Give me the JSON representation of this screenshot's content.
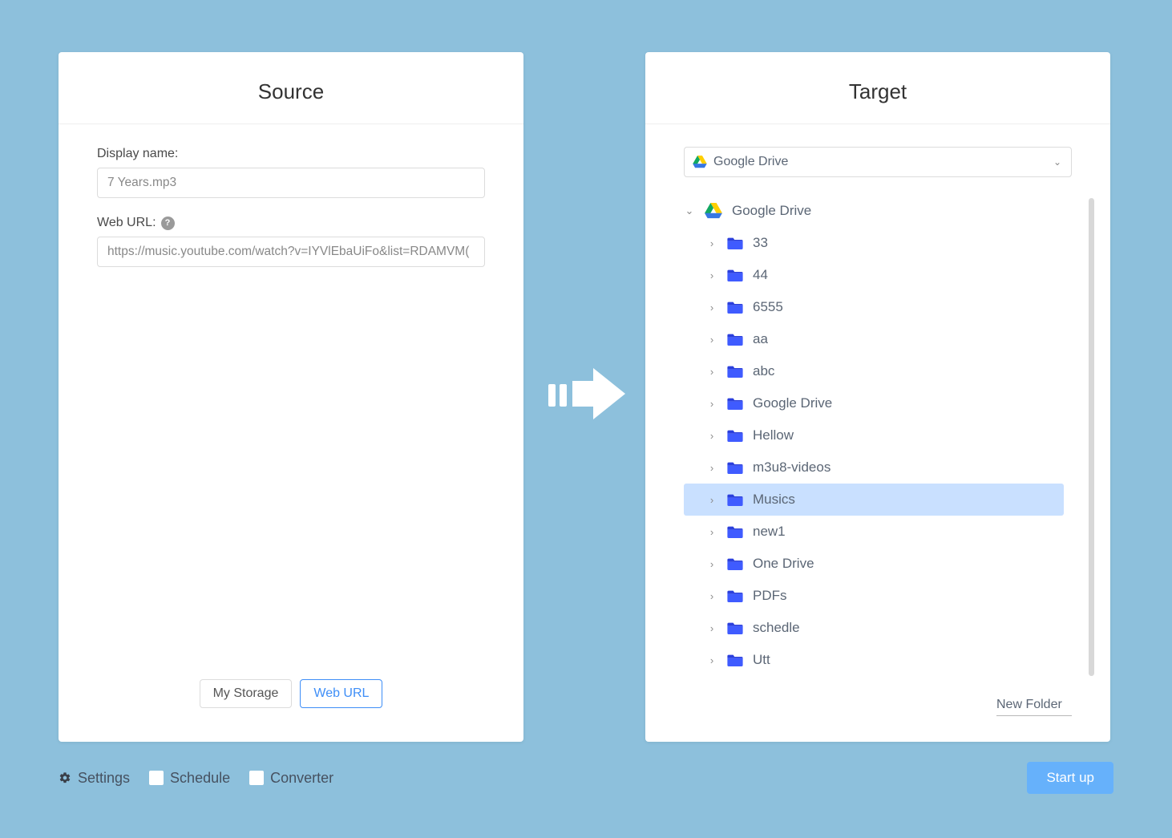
{
  "source": {
    "title": "Source",
    "display_name_label": "Display name:",
    "display_name_value": "7 Years.mp3",
    "web_url_label": "Web URL:",
    "web_url_value": "https://music.youtube.com/watch?v=IYVlEbaUiFo&list=RDAMVM(",
    "tabs": {
      "my_storage": "My Storage",
      "web_url": "Web URL"
    }
  },
  "target": {
    "title": "Target",
    "selected_drive": "Google Drive",
    "root_label": "Google Drive",
    "folders": [
      {
        "name": "33",
        "selected": false
      },
      {
        "name": "44",
        "selected": false
      },
      {
        "name": "6555",
        "selected": false
      },
      {
        "name": "aa",
        "selected": false
      },
      {
        "name": "abc",
        "selected": false
      },
      {
        "name": "Google Drive",
        "selected": false
      },
      {
        "name": "Hellow",
        "selected": false
      },
      {
        "name": "m3u8-videos",
        "selected": false
      },
      {
        "name": "Musics",
        "selected": true
      },
      {
        "name": "new1",
        "selected": false
      },
      {
        "name": "One Drive",
        "selected": false
      },
      {
        "name": "PDFs",
        "selected": false
      },
      {
        "name": "schedle",
        "selected": false
      },
      {
        "name": "Utt",
        "selected": false
      }
    ],
    "new_folder_label": "New Folder"
  },
  "footer": {
    "settings": "Settings",
    "schedule": "Schedule",
    "converter": "Converter",
    "start": "Start up"
  },
  "icons": {
    "help": "?",
    "chevron_down": "⌄",
    "chevron_right": "›"
  }
}
